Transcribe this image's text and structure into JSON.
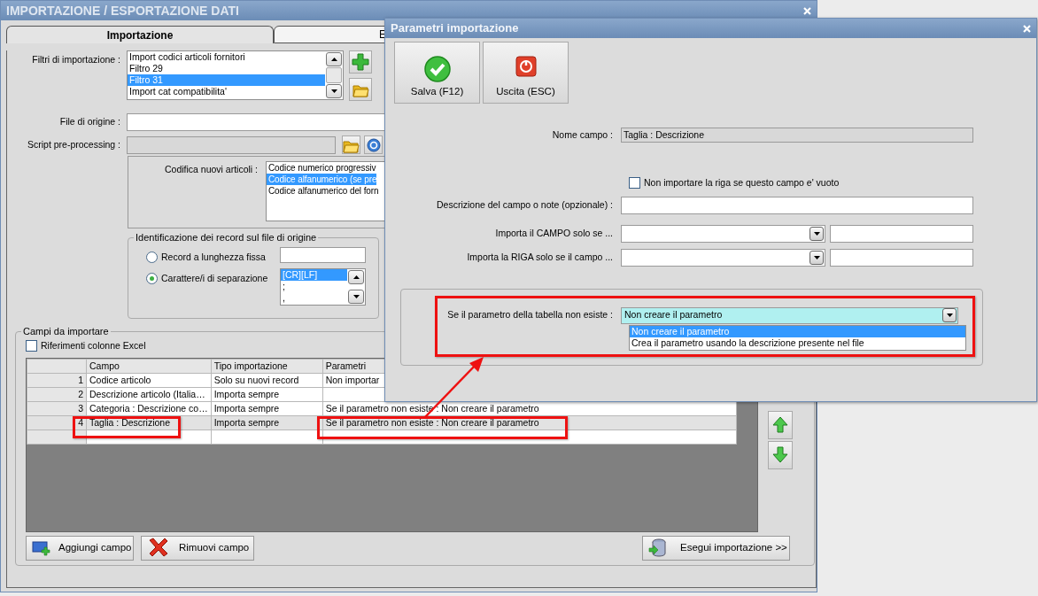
{
  "main_window": {
    "title": "IMPORTAZIONE / ESPORTAZIONE DATI",
    "tabs": [
      {
        "label": "Importazione",
        "selected": true
      },
      {
        "label": "E",
        "selected": false
      }
    ],
    "filters": {
      "label": "Filtri di importazione :",
      "items": [
        {
          "text": "Import codici articoli fornitori",
          "selected": false
        },
        {
          "text": "Filtro 29",
          "selected": false
        },
        {
          "text": "Filtro 31",
          "selected": true
        },
        {
          "text": "Import cat compatibilita'",
          "selected": false
        }
      ]
    },
    "source_file": {
      "label": "File di origine :"
    },
    "script": {
      "label": "Script pre-processing :",
      "disabled": true
    },
    "coding": {
      "label": "Codifica nuovi articoli :",
      "items": [
        {
          "text": "Codice numerico progressiv",
          "selected": false
        },
        {
          "text": "Codice alfanumerico (se pre",
          "selected": true
        },
        {
          "text": "Codice alfanumerico del forn",
          "selected": false
        }
      ]
    },
    "record_id": {
      "title": "Identificazione dei record sul file di origine",
      "options": [
        {
          "label": "Record a lunghezza fissa",
          "selected": false
        },
        {
          "label": "Carattere/i di separazione",
          "selected": true
        }
      ],
      "separators": [
        {
          "text": "[CR][LF]",
          "selected": true
        },
        {
          "text": ";",
          "selected": false
        },
        {
          "text": ",",
          "selected": false
        }
      ]
    },
    "fields": {
      "title": "Campi da importare",
      "excel_refs": {
        "label": "Riferimenti colonne Excel",
        "checked": false
      },
      "table": {
        "columns": [
          "Campo",
          "Tipo importazione",
          "Parametri"
        ],
        "rows": [
          {
            "number": "1",
            "cells": [
              "Codice articolo",
              "Solo su nuovi record",
              "Non importar"
            ],
            "selected": false
          },
          {
            "number": "2",
            "cells": [
              "Descrizione articolo (Italia…",
              "Importa sempre"
            ],
            "selected": false
          },
          {
            "number": "3",
            "cells": [
              "Categoria : Descrizione co…",
              "Importa sempre",
              "Se il parametro non esiste : Non creare il parametro"
            ],
            "selected": false
          },
          {
            "number": "4",
            "cells": [
              "Taglia : Descrizione",
              "Importa sempre",
              "Se il parametro non esiste : Non creare il parametro"
            ],
            "selected": true
          }
        ]
      },
      "buttons": [
        {
          "label": "Aggiungi campo",
          "kind": "add"
        },
        {
          "label": "Rimuovi campo",
          "kind": "remove"
        },
        {
          "label": "Esegui importazione >>",
          "kind": "run"
        }
      ]
    }
  },
  "dialog": {
    "title": "Parametri importazione",
    "buttons": [
      {
        "label": "Salva (F12)",
        "kind": "save"
      },
      {
        "label": "Uscita (ESC)",
        "kind": "exit"
      }
    ],
    "field_name": {
      "label": "Nome campo :",
      "value": "Taglia : Descrizione"
    },
    "skip_empty": {
      "label": "Non importare la riga se questo campo e' vuoto",
      "checked": false
    },
    "description": {
      "label": "Descrizione del campo o note (opzionale) :"
    },
    "conditions": [
      {
        "label": "Importa il CAMPO solo se ..."
      },
      {
        "label": "Importa la RIGA solo se il campo ..."
      }
    ],
    "missing_param": {
      "label": "Se il parametro della tabella non esiste :",
      "value": "Non creare il parametro",
      "expanded": true,
      "options": [
        {
          "text": "Non creare il parametro",
          "selected": true
        },
        {
          "text": "Crea il parametro usando la descrizione presente nel file",
          "selected": false
        }
      ]
    }
  }
}
